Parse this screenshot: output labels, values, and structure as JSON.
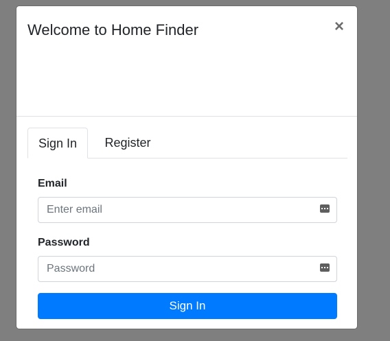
{
  "modal": {
    "title": "Welcome to Home Finder",
    "close_label": "×"
  },
  "tabs": [
    {
      "label": "Sign In",
      "active": true
    },
    {
      "label": "Register",
      "active": false
    }
  ],
  "form": {
    "email": {
      "label": "Email",
      "placeholder": "Enter email",
      "value": ""
    },
    "password": {
      "label": "Password",
      "placeholder": "Password",
      "value": ""
    },
    "submit_label": "Sign In"
  },
  "icons": {
    "close": "close-icon",
    "autofill": "password-manager-key-icon"
  },
  "colors": {
    "backdrop": "#7f7f7f",
    "primary": "#007bff",
    "border": "#dee2e6",
    "input_border": "#ced4da"
  }
}
